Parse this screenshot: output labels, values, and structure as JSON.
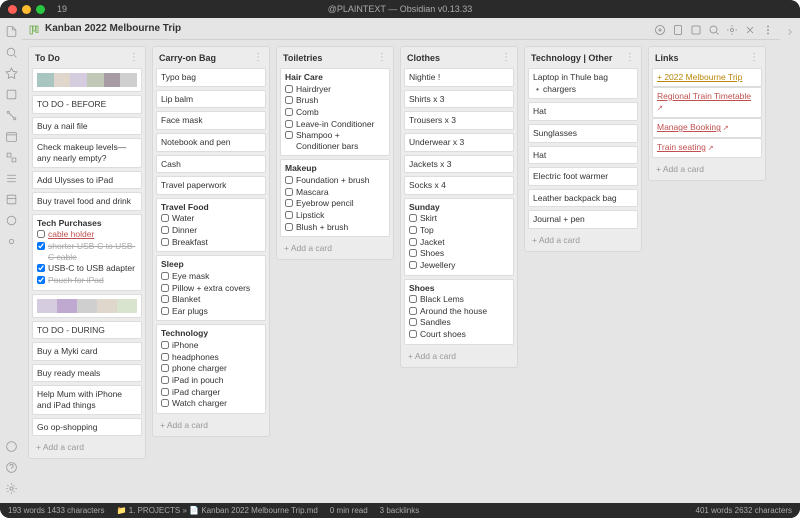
{
  "window": {
    "title": "@PLAINTEXT — Obsidian v0.13.33",
    "tab_count": "19"
  },
  "tab": {
    "title": "Kanban 2022 Melbourne Trip"
  },
  "swatches1": [
    "#a9c5c0",
    "#e0d7cc",
    "#d6cce0",
    "#bfc9b6",
    "#a79ca4",
    "#cfcfcf"
  ],
  "swatches2": [
    "#d6cce0",
    "#bfa9d0",
    "#cfcfcf",
    "#e0d7cc",
    "#d9e4cf"
  ],
  "columns": {
    "todo": {
      "title": "To Do",
      "before_header": "TO DO - BEFORE",
      "before": [
        "Buy a nail file",
        "Check makeup levels—any nearly empty?",
        "Add Ulysses to iPad",
        "Buy travel food and drink"
      ],
      "tech_header": "Tech Purchases",
      "tech_checks": [
        {
          "label": "cable holder",
          "link": true,
          "checked": false,
          "done": false
        },
        {
          "label": "shorter USB-C to USB-C cable",
          "checked": true,
          "done": true
        },
        {
          "label": "USB-C to USB adapter",
          "checked": true,
          "done": false
        },
        {
          "label": "Pouch for iPad",
          "checked": true,
          "done": true
        }
      ],
      "during_header": "TO DO - DURING",
      "during": [
        "Buy a Myki card",
        "Buy ready meals",
        "Help Mum with iPhone and iPad things",
        "Go op-shopping"
      ],
      "add": "+ Add a card"
    },
    "carry": {
      "title": "Carry-on Bag",
      "items": [
        "Typo bag",
        "Lip balm",
        "Face mask",
        "Notebook and pen",
        "Cash",
        "Travel paperwork"
      ],
      "food_header": "Travel Food",
      "food": [
        "Water",
        "Dinner",
        "Breakfast"
      ],
      "sleep_header": "Sleep",
      "sleep": [
        "Eye mask",
        "Pillow + extra covers",
        "Blanket",
        "Ear plugs"
      ],
      "tech_header": "Technology",
      "tech": [
        "iPhone",
        "headphones",
        "phone charger",
        "iPad in pouch",
        "iPad charger",
        "Watch charger"
      ],
      "add": "+ Add a card"
    },
    "toiletries": {
      "title": "Toiletries",
      "hair_header": "Hair Care",
      "hair": [
        "Hairdryer",
        "Brush",
        "Comb",
        "Leave-in Conditioner",
        "Shampoo + Conditioner bars"
      ],
      "makeup_header": "Makeup",
      "makeup": [
        "Foundation + brush",
        "Mascara",
        "Eyebrow pencil",
        "Lipstick",
        "Blush + brush"
      ],
      "add": "+ Add a card"
    },
    "clothes": {
      "title": "Clothes",
      "items": [
        "Nightie !",
        "Shirts x 3",
        "Trousers x 3",
        "Underwear x 3",
        "Jackets x 3",
        "Socks x 4"
      ],
      "sunday_header": "Sunday",
      "sunday": [
        "Skirt",
        "Top",
        "Jacket",
        "Shoes",
        "Jewellery"
      ],
      "shoes_header": "Shoes",
      "shoes": [
        "Black Lems",
        "Around the house",
        "Sandles",
        "Court shoes"
      ],
      "add": "+ Add a card"
    },
    "tech": {
      "title": "Technology | Other",
      "thule_header": "Laptop in Thule bag",
      "thule_bullets": [
        "chargers"
      ],
      "items": [
        "Hat",
        "Sunglasses",
        "Hat",
        "Electric foot warmer",
        "Leather backpack bag",
        "Journal + pen"
      ],
      "add": "+ Add a card"
    },
    "links": {
      "title": "Links",
      "items": [
        {
          "label": "+ 2022 Melbourne Trip",
          "kind": "internal"
        },
        {
          "label": "Regional Train Timetable",
          "kind": "ext"
        },
        {
          "label": "Manage Booking",
          "kind": "ext"
        },
        {
          "label": "Train seating",
          "kind": "ext"
        }
      ],
      "add": "+ Add a card"
    }
  },
  "status": {
    "left": "193 words 1433 characters",
    "crumb1": "1. PROJECTS »",
    "crumb2": "Kanban 2022 Melbourne Trip.md",
    "read": "0 min read",
    "backlinks": "3 backlinks",
    "right": "401 words   2632 characters"
  }
}
